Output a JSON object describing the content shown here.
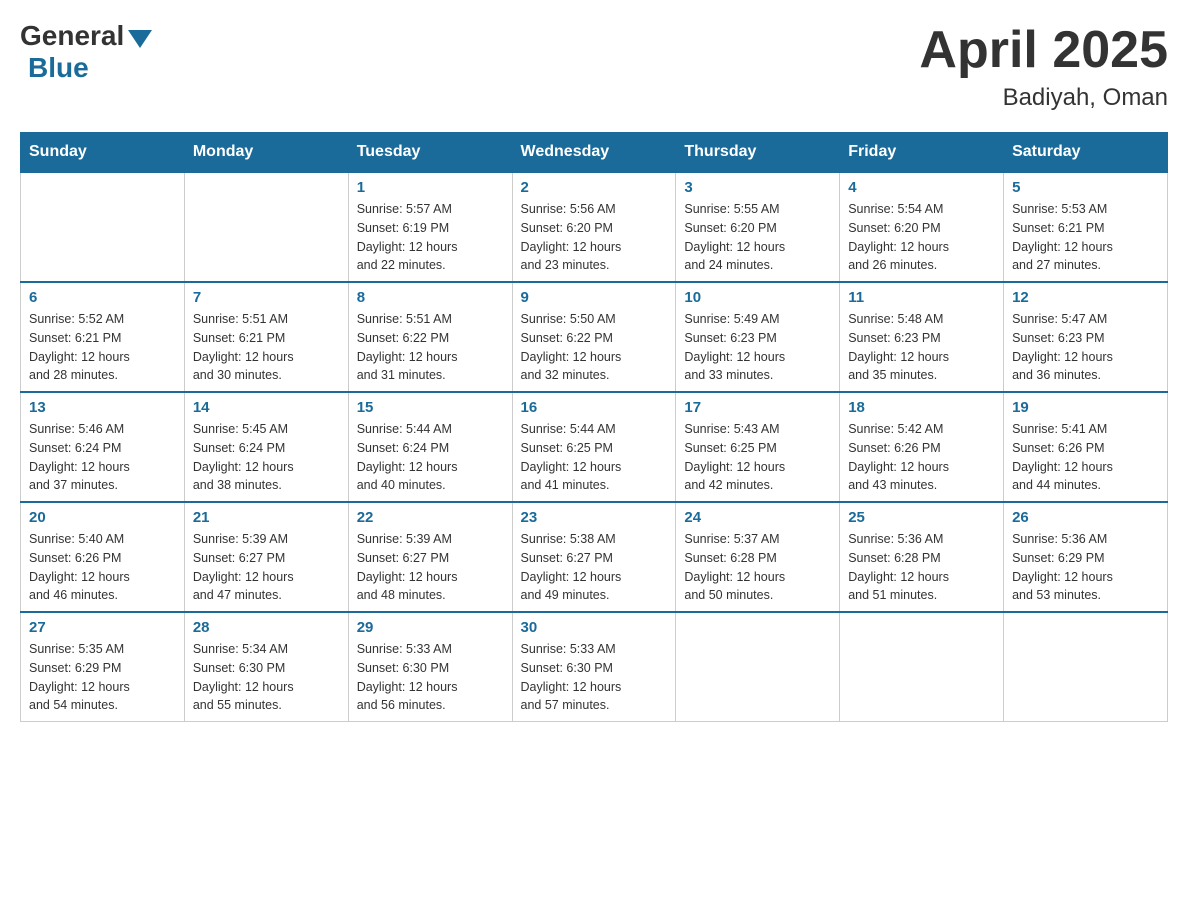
{
  "header": {
    "logo": {
      "general": "General",
      "blue": "Blue"
    },
    "title": "April 2025",
    "location": "Badiyah, Oman"
  },
  "days_of_week": [
    "Sunday",
    "Monday",
    "Tuesday",
    "Wednesday",
    "Thursday",
    "Friday",
    "Saturday"
  ],
  "weeks": [
    [
      {
        "day": "",
        "info": ""
      },
      {
        "day": "",
        "info": ""
      },
      {
        "day": "1",
        "info": "Sunrise: 5:57 AM\nSunset: 6:19 PM\nDaylight: 12 hours\nand 22 minutes."
      },
      {
        "day": "2",
        "info": "Sunrise: 5:56 AM\nSunset: 6:20 PM\nDaylight: 12 hours\nand 23 minutes."
      },
      {
        "day": "3",
        "info": "Sunrise: 5:55 AM\nSunset: 6:20 PM\nDaylight: 12 hours\nand 24 minutes."
      },
      {
        "day": "4",
        "info": "Sunrise: 5:54 AM\nSunset: 6:20 PM\nDaylight: 12 hours\nand 26 minutes."
      },
      {
        "day": "5",
        "info": "Sunrise: 5:53 AM\nSunset: 6:21 PM\nDaylight: 12 hours\nand 27 minutes."
      }
    ],
    [
      {
        "day": "6",
        "info": "Sunrise: 5:52 AM\nSunset: 6:21 PM\nDaylight: 12 hours\nand 28 minutes."
      },
      {
        "day": "7",
        "info": "Sunrise: 5:51 AM\nSunset: 6:21 PM\nDaylight: 12 hours\nand 30 minutes."
      },
      {
        "day": "8",
        "info": "Sunrise: 5:51 AM\nSunset: 6:22 PM\nDaylight: 12 hours\nand 31 minutes."
      },
      {
        "day": "9",
        "info": "Sunrise: 5:50 AM\nSunset: 6:22 PM\nDaylight: 12 hours\nand 32 minutes."
      },
      {
        "day": "10",
        "info": "Sunrise: 5:49 AM\nSunset: 6:23 PM\nDaylight: 12 hours\nand 33 minutes."
      },
      {
        "day": "11",
        "info": "Sunrise: 5:48 AM\nSunset: 6:23 PM\nDaylight: 12 hours\nand 35 minutes."
      },
      {
        "day": "12",
        "info": "Sunrise: 5:47 AM\nSunset: 6:23 PM\nDaylight: 12 hours\nand 36 minutes."
      }
    ],
    [
      {
        "day": "13",
        "info": "Sunrise: 5:46 AM\nSunset: 6:24 PM\nDaylight: 12 hours\nand 37 minutes."
      },
      {
        "day": "14",
        "info": "Sunrise: 5:45 AM\nSunset: 6:24 PM\nDaylight: 12 hours\nand 38 minutes."
      },
      {
        "day": "15",
        "info": "Sunrise: 5:44 AM\nSunset: 6:24 PM\nDaylight: 12 hours\nand 40 minutes."
      },
      {
        "day": "16",
        "info": "Sunrise: 5:44 AM\nSunset: 6:25 PM\nDaylight: 12 hours\nand 41 minutes."
      },
      {
        "day": "17",
        "info": "Sunrise: 5:43 AM\nSunset: 6:25 PM\nDaylight: 12 hours\nand 42 minutes."
      },
      {
        "day": "18",
        "info": "Sunrise: 5:42 AM\nSunset: 6:26 PM\nDaylight: 12 hours\nand 43 minutes."
      },
      {
        "day": "19",
        "info": "Sunrise: 5:41 AM\nSunset: 6:26 PM\nDaylight: 12 hours\nand 44 minutes."
      }
    ],
    [
      {
        "day": "20",
        "info": "Sunrise: 5:40 AM\nSunset: 6:26 PM\nDaylight: 12 hours\nand 46 minutes."
      },
      {
        "day": "21",
        "info": "Sunrise: 5:39 AM\nSunset: 6:27 PM\nDaylight: 12 hours\nand 47 minutes."
      },
      {
        "day": "22",
        "info": "Sunrise: 5:39 AM\nSunset: 6:27 PM\nDaylight: 12 hours\nand 48 minutes."
      },
      {
        "day": "23",
        "info": "Sunrise: 5:38 AM\nSunset: 6:27 PM\nDaylight: 12 hours\nand 49 minutes."
      },
      {
        "day": "24",
        "info": "Sunrise: 5:37 AM\nSunset: 6:28 PM\nDaylight: 12 hours\nand 50 minutes."
      },
      {
        "day": "25",
        "info": "Sunrise: 5:36 AM\nSunset: 6:28 PM\nDaylight: 12 hours\nand 51 minutes."
      },
      {
        "day": "26",
        "info": "Sunrise: 5:36 AM\nSunset: 6:29 PM\nDaylight: 12 hours\nand 53 minutes."
      }
    ],
    [
      {
        "day": "27",
        "info": "Sunrise: 5:35 AM\nSunset: 6:29 PM\nDaylight: 12 hours\nand 54 minutes."
      },
      {
        "day": "28",
        "info": "Sunrise: 5:34 AM\nSunset: 6:30 PM\nDaylight: 12 hours\nand 55 minutes."
      },
      {
        "day": "29",
        "info": "Sunrise: 5:33 AM\nSunset: 6:30 PM\nDaylight: 12 hours\nand 56 minutes."
      },
      {
        "day": "30",
        "info": "Sunrise: 5:33 AM\nSunset: 6:30 PM\nDaylight: 12 hours\nand 57 minutes."
      },
      {
        "day": "",
        "info": ""
      },
      {
        "day": "",
        "info": ""
      },
      {
        "day": "",
        "info": ""
      }
    ]
  ]
}
